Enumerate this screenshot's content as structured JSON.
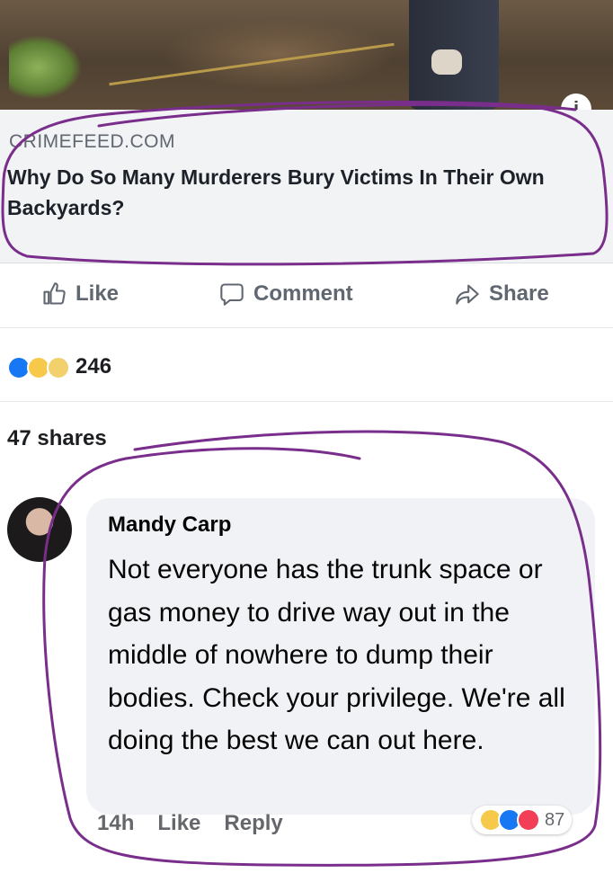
{
  "post": {
    "domain": "CRIMEFEED.COM",
    "headline": "Why Do So Many Murderers Bury Victims In Their Own Backyards?"
  },
  "actions": {
    "like_label": "Like",
    "comment_label": "Comment",
    "share_label": "Share"
  },
  "reactions": {
    "count": "246",
    "icons": [
      "like-reaction",
      "wow-reaction",
      "sad-reaction"
    ]
  },
  "shares": {
    "label": "47 shares"
  },
  "comment": {
    "author": "Mandy Carp",
    "text": "Not everyone has the trunk space or gas money to drive way out in the middle of nowhere to dump their bodies. Check your privilege. We're all doing the best we can out here.",
    "time": "14h",
    "like_label": "Like",
    "reply_label": "Reply",
    "reaction_count": "87",
    "reaction_icons": [
      "haha-reaction",
      "like-reaction",
      "love-reaction"
    ]
  },
  "colors": {
    "facebook_blue": "#1877f2",
    "annotation_purple": "#7a2e8c"
  }
}
